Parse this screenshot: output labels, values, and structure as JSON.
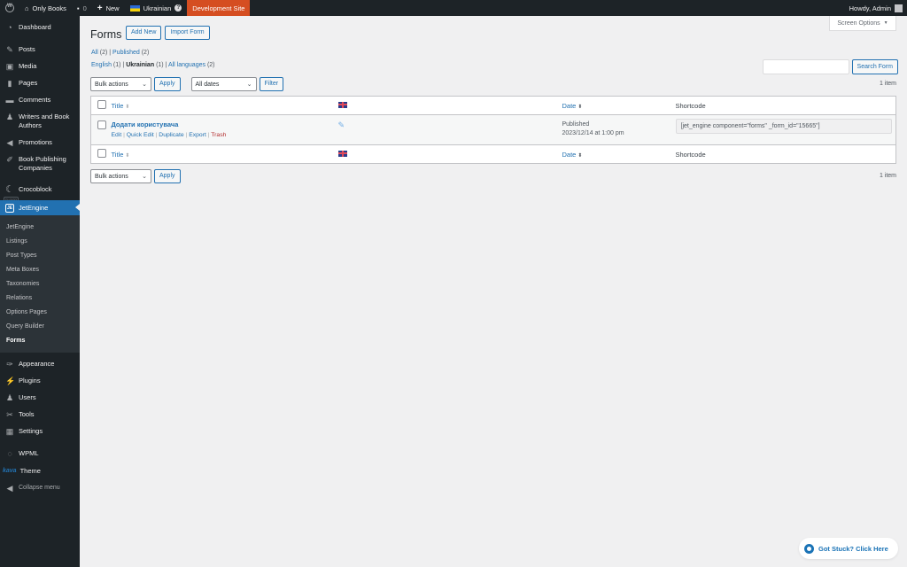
{
  "adminbar": {
    "site_name": "Only Books",
    "comments_count": "0",
    "new_label": "New",
    "language": "Ukrainian",
    "dev_site": "Development Site",
    "howdy": "Howdy, Admin"
  },
  "sidebar": {
    "items": [
      {
        "label": "Dashboard",
        "icon": "dashboard-icon"
      },
      {
        "label": "Posts",
        "icon": "pin-icon"
      },
      {
        "label": "Media",
        "icon": "media-icon"
      },
      {
        "label": "Pages",
        "icon": "pages-icon"
      },
      {
        "label": "Comments",
        "icon": "comment-icon"
      },
      {
        "label": "Writers and Book Authors",
        "icon": "user-icon"
      },
      {
        "label": "Promotions",
        "icon": "megaphone-icon"
      },
      {
        "label": "Book Publishing Companies",
        "icon": "edit-icon"
      },
      {
        "label": "Crocoblock",
        "icon": "crocoblock-icon"
      },
      {
        "label": "JetEngine",
        "icon": "jetengine-icon"
      }
    ],
    "plugins_badge": "PLUGINS",
    "submenu": [
      "JetEngine",
      "Listings",
      "Post Types",
      "Meta Boxes",
      "Taxonomies",
      "Relations",
      "Options Pages",
      "Query Builder",
      "Forms"
    ],
    "bottom_items": [
      {
        "label": "Appearance",
        "icon": "brush-icon"
      },
      {
        "label": "Plugins",
        "icon": "plugin-icon"
      },
      {
        "label": "Users",
        "icon": "users-icon"
      },
      {
        "label": "Tools",
        "icon": "wrench-icon"
      },
      {
        "label": "Settings",
        "icon": "settings-icon"
      },
      {
        "label": "WPML",
        "icon": "wpml-icon"
      },
      {
        "label": "Theme",
        "icon": "kava-icon",
        "logo_text": "kava"
      },
      {
        "label": "Collapse menu",
        "icon": "collapse-icon"
      }
    ]
  },
  "main": {
    "screen_options": "Screen Options",
    "title": "Forms",
    "add_new": "Add New",
    "import_form": "Import Form",
    "status_filters": {
      "all": "All",
      "all_count": "(2)",
      "published": "Published",
      "published_count": "(2)"
    },
    "lang_filters": {
      "english": "English",
      "english_count": "(1)",
      "ukrainian": "Ukrainian",
      "ukrainian_count": "(1)",
      "all_languages": "All languages",
      "all_languages_count": "(2)"
    },
    "search_button": "Search Form",
    "search_value": "",
    "items_count": "1 item",
    "bulk_actions": "Bulk actions",
    "apply": "Apply",
    "all_dates": "All dates",
    "filter": "Filter",
    "columns": {
      "title": "Title",
      "date": "Date",
      "shortcode": "Shortcode"
    },
    "rows": [
      {
        "title": "Додати користувача",
        "actions": {
          "edit": "Edit",
          "quick_edit": "Quick Edit",
          "duplicate": "Duplicate",
          "export": "Export",
          "trash": "Trash"
        },
        "status": "Published",
        "date": "2023/12/14 at 1:00 pm",
        "shortcode": "[jet_engine component=\"forms\" _form_id=\"15665\"]"
      }
    ],
    "got_stuck": "Got Stuck? Click Here"
  }
}
